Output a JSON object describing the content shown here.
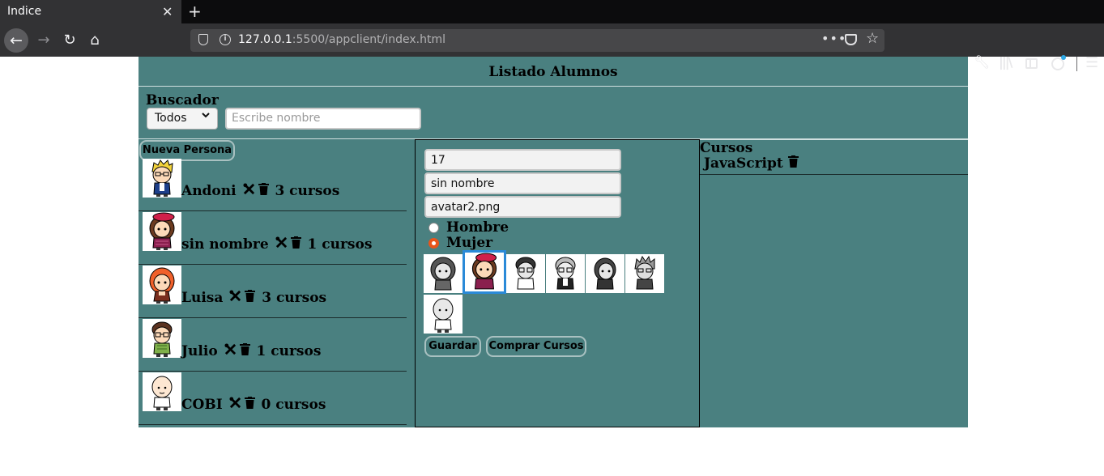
{
  "browser": {
    "tab_title": "Indice",
    "tab_close": "✕",
    "new_tab": "+",
    "url_host": "127.0.0.1",
    "url_rest": ":5500/appclient/index.html",
    "more": "•••"
  },
  "header": {
    "title": "Listado Alumnos"
  },
  "buscador": {
    "label": "Buscador",
    "filter_value": "Todos",
    "search_placeholder": "Escribe nombre"
  },
  "personas": {
    "new_button": "Nueva Persona",
    "items": [
      {
        "name": "Andoni",
        "cursos": "3 cursos"
      },
      {
        "name": "sin nombre",
        "cursos": "1 cursos"
      },
      {
        "name": "Luisa",
        "cursos": "3 cursos"
      },
      {
        "name": "Julio",
        "cursos": "1 cursos"
      },
      {
        "name": "COBI",
        "cursos": "0 cursos"
      }
    ]
  },
  "form": {
    "id_value": "17",
    "nombre_value": "sin nombre",
    "avatar_value": "avatar2.png",
    "gender_options": [
      "Hombre",
      "Mujer"
    ],
    "gender_selected": "Mujer",
    "save_button": "Guardar",
    "buy_button": "Comprar Cursos"
  },
  "cursos": {
    "title": "Cursos",
    "items": [
      {
        "name": "JavaScript"
      }
    ]
  },
  "icons": {
    "edit": "✂",
    "delete": "trash"
  }
}
